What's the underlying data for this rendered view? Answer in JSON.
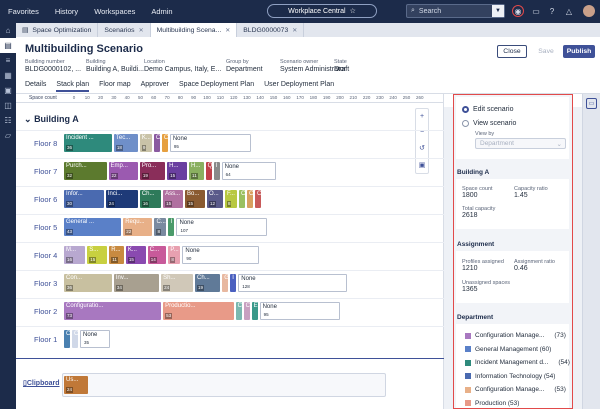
{
  "topbar": {
    "nav": [
      "Favorites",
      "History",
      "Workspaces",
      "Admin"
    ],
    "instance": "Workplace Central",
    "search_placeholder": "Search"
  },
  "tabs": [
    {
      "label": "Space Optimization",
      "active": false
    },
    {
      "label": "Scenarios",
      "active": false
    },
    {
      "label": "Multibuilding Scena...",
      "active": true
    },
    {
      "label": "BLDG0000073",
      "active": false
    }
  ],
  "header": {
    "title": "Multibuilding Scenario",
    "close_label": "Close",
    "save_label": "Save",
    "publish_label": "Publish",
    "fields": [
      {
        "label": "Building number",
        "value": "BLDG0000102, ..."
      },
      {
        "label": "Building",
        "value": "Building A, Buildi..."
      },
      {
        "label": "Location",
        "value": "Demo Campus, Italy, E..."
      },
      {
        "label": "Group by",
        "value": "Department"
      },
      {
        "label": "Scenario owner",
        "value": "System Administrator"
      },
      {
        "label": "State",
        "value": "Draft"
      }
    ],
    "subtabs": [
      {
        "label": "Details",
        "active": false
      },
      {
        "label": "Stack plan",
        "active": true
      },
      {
        "label": "Floor map",
        "active": false
      },
      {
        "label": "Approver",
        "active": false
      },
      {
        "label": "Space Deployment Plan",
        "active": false
      },
      {
        "label": "User Deployment Plan",
        "active": false
      }
    ]
  },
  "stack": {
    "scale_label": "Space count",
    "ticks": [
      "0",
      "10",
      "20",
      "30",
      "40",
      "50",
      "60",
      "70",
      "80",
      "90",
      "100",
      "110",
      "120",
      "130",
      "140",
      "150",
      "160",
      "170",
      "180",
      "190",
      "200",
      "210",
      "220",
      "230",
      "240",
      "250",
      "260"
    ],
    "building": "Building A",
    "clipboard_label": "Clipboard",
    "floors": [
      {
        "name": "Floor 8",
        "tiles": [
          {
            "label": "Incident ...",
            "count": "36",
            "color": "#2e8a7c"
          },
          {
            "label": "Tec...",
            "count": "18",
            "color": "#6f8fc9"
          },
          {
            "label": "K...",
            "count": "9",
            "color": "#c9c3a8"
          },
          {
            "label": "C",
            "count": "",
            "color": "#8a5aa0"
          },
          {
            "label": "C",
            "count": "",
            "color": "#e6a040"
          },
          {
            "label": "None",
            "count": "95",
            "color": "#ffffff",
            "none": true
          }
        ]
      },
      {
        "name": "Floor 7",
        "tiles": [
          {
            "label": "Purch...",
            "count": "32",
            "color": "#5c7a2e"
          },
          {
            "label": "Emp...",
            "count": "22",
            "color": "#9b5ab0"
          },
          {
            "label": "Pro...",
            "count": "19",
            "color": "#8a2e5a"
          },
          {
            "label": "H...",
            "count": "15",
            "color": "#6a3fa0"
          },
          {
            "label": "H...",
            "count": "11",
            "color": "#8ab060"
          },
          {
            "label": "Q",
            "count": "",
            "color": "#c0404a"
          },
          {
            "label": "I",
            "count": "",
            "color": "#8a8a8a"
          },
          {
            "label": "None",
            "count": "64",
            "color": "#ffffff",
            "none": true
          }
        ]
      },
      {
        "name": "Floor 6",
        "tiles": [
          {
            "label": "Infor...",
            "count": "30",
            "color": "#4a6ab0"
          },
          {
            "label": "Inci...",
            "count": "24",
            "color": "#1e3a78"
          },
          {
            "label": "Ch...",
            "count": "16",
            "color": "#2e7a5a"
          },
          {
            "label": "Ass...",
            "count": "15",
            "color": "#b070a0"
          },
          {
            "label": "Bo...",
            "count": "15",
            "color": "#8a5a30"
          },
          {
            "label": "O...",
            "count": "12",
            "color": "#5a5a8a"
          },
          {
            "label": "F...",
            "count": "8",
            "color": "#b8c840"
          },
          {
            "label": "C",
            "count": "",
            "color": "#9ac060"
          },
          {
            "label": "C",
            "count": "",
            "color": "#d8a060"
          },
          {
            "label": "C",
            "count": "",
            "color": "#c85a5a"
          }
        ]
      },
      {
        "name": "Floor 5",
        "tiles": [
          {
            "label": "General ...",
            "count": "43",
            "color": "#5a80c8"
          },
          {
            "label": "Requ...",
            "count": "22",
            "color": "#e8b088"
          },
          {
            "label": "C...",
            "count": "8",
            "color": "#7a8aa0"
          },
          {
            "label": "I",
            "count": "",
            "color": "#4a9a6a"
          },
          {
            "label": "None",
            "count": "107",
            "color": "#ffffff",
            "none": true
          }
        ]
      },
      {
        "name": "Floor 4",
        "tiles": [
          {
            "label": "M...",
            "count": "16",
            "color": "#b8a8d0"
          },
          {
            "label": "S...",
            "count": "15",
            "color": "#c8d040"
          },
          {
            "label": "R...",
            "count": "11",
            "color": "#c88a40"
          },
          {
            "label": "K...",
            "count": "15",
            "color": "#8a4ab0"
          },
          {
            "label": "C...",
            "count": "14",
            "color": "#c85a9a"
          },
          {
            "label": "P...",
            "count": "8",
            "color": "#e8a0b0"
          },
          {
            "label": "None",
            "count": "90",
            "color": "#ffffff",
            "none": true
          }
        ]
      },
      {
        "name": "Floor 3",
        "tiles": [
          {
            "label": "Con...",
            "count": "36",
            "color": "#c8c0a0"
          },
          {
            "label": "Inv...",
            "count": "34",
            "color": "#a8a090"
          },
          {
            "label": "Sh...",
            "count": "24",
            "color": "#d0c8b8"
          },
          {
            "label": "Ch...",
            "count": "19",
            "color": "#607a98"
          },
          {
            "label": "G",
            "count": "",
            "color": "#e8b8a0"
          },
          {
            "label": "I",
            "count": "",
            "color": "#4a60c0"
          },
          {
            "label": "None",
            "count": "128",
            "color": "#ffffff",
            "none": true
          }
        ]
      },
      {
        "name": "Floor 2",
        "tiles": [
          {
            "label": "Configuratio...",
            "count": "73",
            "color": "#a878c0"
          },
          {
            "label": "Productio...",
            "count": "53",
            "color": "#e89a88"
          },
          {
            "label": "C",
            "count": "",
            "color": "#7ab8b0"
          },
          {
            "label": "C",
            "count": "",
            "color": "#c8a0c0"
          },
          {
            "label": "E",
            "count": "",
            "color": "#3a9a8a"
          },
          {
            "label": "None",
            "count": "95",
            "color": "#ffffff",
            "none": true
          }
        ]
      },
      {
        "name": "Floor 1",
        "tiles": [
          {
            "label": "C",
            "count": "",
            "color": "#4a80b0"
          },
          {
            "label": "C",
            "count": "",
            "color": "#d0d8e8"
          },
          {
            "label": "None",
            "count": "35",
            "color": "#ffffff",
            "none": true
          }
        ]
      }
    ],
    "clipboard_tiles": [
      {
        "label": "Us...",
        "count": "24",
        "color": "#c07838"
      }
    ]
  },
  "side": {
    "edit_label": "Edit scenario",
    "view_label": "View scenario",
    "viewby_label": "View by",
    "viewby_value": "Department",
    "building_head": "Building A",
    "space_count_label": "Space count",
    "space_count": "1800",
    "capacity_ratio_label": "Capacity ratio",
    "capacity_ratio": "1.45",
    "total_capacity_label": "Total capacity",
    "total_capacity": "2618",
    "assignment_head": "Assignment",
    "profiles_label": "Profiles assigned",
    "profiles": "1210",
    "assign_ratio_label": "Assignment ratio",
    "assign_ratio": "0.46",
    "unassigned_label": "Unassigned spaces",
    "unassigned": "1365",
    "department_head": "Department",
    "departments": [
      {
        "name": "Configuration Manage...",
        "count": "(73)",
        "color": "#a878c0"
      },
      {
        "name": "General Management (60)",
        "count": "",
        "color": "#5a80c8"
      },
      {
        "name": "Incident Management d...",
        "count": "(54)",
        "color": "#2e8a7c"
      },
      {
        "name": "Information Technology (54)",
        "count": "",
        "color": "#4a6ab0"
      },
      {
        "name": "Configuration Manage...",
        "count": "(53)",
        "color": "#e8b088"
      },
      {
        "name": "Production (53)",
        "count": "",
        "color": "#e89a88"
      }
    ]
  }
}
